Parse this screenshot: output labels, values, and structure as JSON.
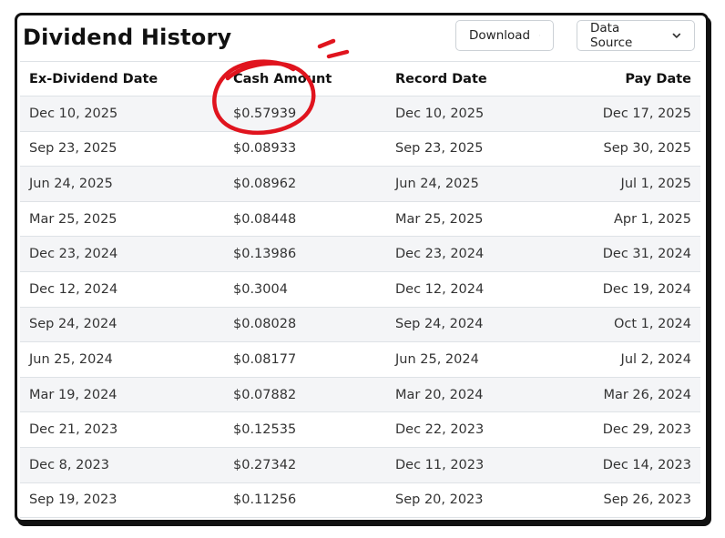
{
  "header": {
    "title": "Dividend History",
    "download_label": "Download",
    "data_source_label": "Data Source"
  },
  "table": {
    "columns": [
      "Ex-Dividend Date",
      "Cash Amount",
      "Record Date",
      "Pay Date"
    ],
    "rows": [
      [
        "Dec 10, 2025",
        "$0.57939",
        "Dec 10, 2025",
        "Dec 17, 2025"
      ],
      [
        "Sep 23, 2025",
        "$0.08933",
        "Sep 23, 2025",
        "Sep 30, 2025"
      ],
      [
        "Jun 24, 2025",
        "$0.08962",
        "Jun 24, 2025",
        "Jul 1, 2025"
      ],
      [
        "Mar 25, 2025",
        "$0.08448",
        "Mar 25, 2025",
        "Apr 1, 2025"
      ],
      [
        "Dec 23, 2024",
        "$0.13986",
        "Dec 23, 2024",
        "Dec 31, 2024"
      ],
      [
        "Dec 12, 2024",
        "$0.3004",
        "Dec 12, 2024",
        "Dec 19, 2024"
      ],
      [
        "Sep 24, 2024",
        "$0.08028",
        "Sep 24, 2024",
        "Oct 1, 2024"
      ],
      [
        "Jun 25, 2024",
        "$0.08177",
        "Jun 25, 2024",
        "Jul 2, 2024"
      ],
      [
        "Mar 19, 2024",
        "$0.07882",
        "Mar 20, 2024",
        "Mar 26, 2024"
      ],
      [
        "Dec 21, 2023",
        "$0.12535",
        "Dec 22, 2023",
        "Dec 29, 2023"
      ],
      [
        "Dec 8, 2023",
        "$0.27342",
        "Dec 11, 2023",
        "Dec 14, 2023"
      ],
      [
        "Sep 19, 2023",
        "$0.11256",
        "Sep 20, 2023",
        "Sep 26, 2023"
      ]
    ]
  },
  "icons": {
    "download_chevron": "chevron-down-icon",
    "source_chevron": "chevron-down-icon"
  },
  "colors": {
    "annotation": "#e0141e",
    "stripe": "#f4f5f7"
  }
}
